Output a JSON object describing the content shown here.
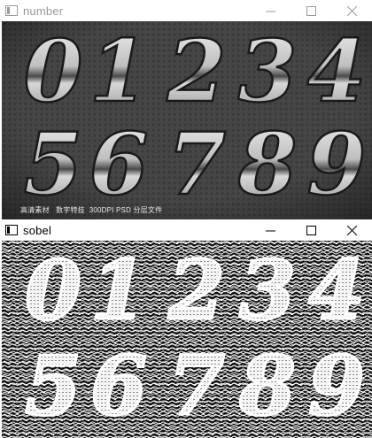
{
  "windows": {
    "top": {
      "title": "number",
      "caption": "高清素材   数字特技  300DPI PSD 分层文件"
    },
    "bottom": {
      "title": "sobel"
    }
  },
  "controls": {
    "minimize_icon": "minimize-icon",
    "maximize_icon": "maximize-icon",
    "close_icon": "close-icon"
  },
  "digits_row1": [
    "0",
    "1",
    "2",
    "3",
    "4"
  ],
  "digits_row2": [
    "5",
    "6",
    "7",
    "8",
    "9"
  ],
  "colors": {
    "top_bg": "#4a4a4a",
    "sobel_bg": "#1a1a1a",
    "inactive_title": "#9a9a9a",
    "active_title": "#000000"
  }
}
